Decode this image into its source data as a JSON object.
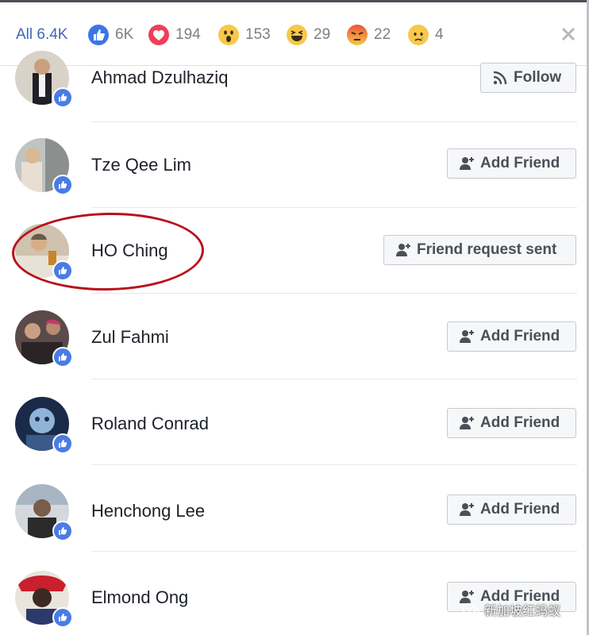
{
  "reactions_bar": {
    "all_label": "All 6.4K",
    "tabs": [
      {
        "icon": "like-icon",
        "count": "6K"
      },
      {
        "icon": "love-icon",
        "count": "194"
      },
      {
        "icon": "wow-icon",
        "count": "153"
      },
      {
        "icon": "haha-icon",
        "count": "29"
      },
      {
        "icon": "angry-icon",
        "count": "22"
      },
      {
        "icon": "sad-icon",
        "count": "4"
      }
    ],
    "close_icon": "close-icon"
  },
  "people": [
    {
      "name": "Ahmad Dzulhaziq",
      "button": "Follow",
      "button_icon": "rss-icon"
    },
    {
      "name": "Tze Qee Lim",
      "button": "Add Friend",
      "button_icon": "add-friend-icon"
    },
    {
      "name": "HO Ching",
      "button": "Friend request sent",
      "button_icon": "add-friend-icon"
    },
    {
      "name": "Zul Fahmi",
      "button": "Add Friend",
      "button_icon": "add-friend-icon"
    },
    {
      "name": "Roland Conrad",
      "button": "Add Friend",
      "button_icon": "add-friend-icon"
    },
    {
      "name": "Henchong Lee",
      "button": "Add Friend",
      "button_icon": "add-friend-icon"
    },
    {
      "name": "Elmond Ong",
      "button": "Add Friend",
      "button_icon": "add-friend-icon"
    }
  ],
  "watermark": {
    "text": "新加坡红蚂蚁"
  },
  "colors": {
    "accent": "#4267b2",
    "like_badge": "#4a7ce4",
    "highlight_circle": "#b8121d"
  }
}
